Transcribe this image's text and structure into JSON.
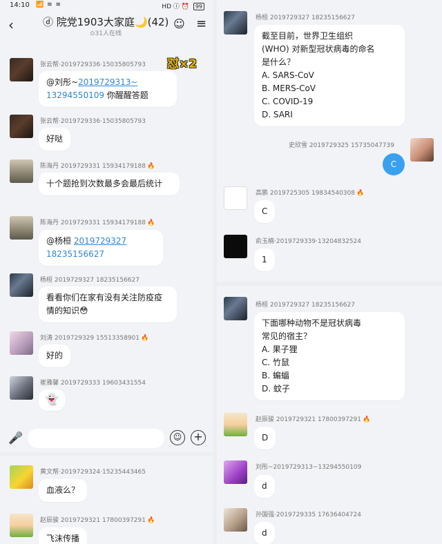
{
  "status": {
    "time": "14:10",
    "signal": "📶 ≋ ≋",
    "right": "HD ⓘ ⏰ ",
    "battery": "99"
  },
  "header": {
    "back": "‹",
    "title": "ⓓ 院党1903大家庭🌙(42)",
    "subtitle": "⊙31人在线",
    "hat_icon": "☺",
    "menu_icon": "≡"
  },
  "badge_x2": "怼×2",
  "left_messages": [
    {
      "name": "张云帮·2019729336·15035805793",
      "text": "@刘彤~2019729313~13294550109 你醒醒答题",
      "mention": "2019729313~",
      "number": "13294550109",
      "tail": " 你醒醒答题",
      "lead": "@刘彤~"
    },
    {
      "name": "张云帮·2019729336·15035805793",
      "text": "好哒"
    },
    {
      "name": "陈海丹 2019729331 15934179188",
      "fire": "🔥",
      "text": "十个题抢到次数最多会最后统计"
    },
    {
      "name": "陈海丹 2019729331 15934179188",
      "fire": "🔥",
      "lead": "@杨桓 ",
      "mention": "2019729327",
      "number": "18235156627"
    },
    {
      "name": "杨桓 2019729327 18235156627",
      "text": "看看你们在家有没有关注防疫疫情的知识",
      "emoji": "😳"
    },
    {
      "name": "刘涛 2019729329 15513358901",
      "fire": "🔥",
      "text": "好的"
    },
    {
      "name": "崔雅馨 2019729333 19603431554",
      "text": "👻"
    }
  ],
  "input": {
    "placeholder": "",
    "mic_icon": "🎤",
    "emoji_icon": "☺",
    "plus_icon": "+"
  },
  "left_b_messages": [
    {
      "name": "黄文帮·2019729324·15235443465",
      "text": "血液么？"
    },
    {
      "name": "赵辰骏 2019729321 17800397291",
      "fire": "🔥",
      "text": "飞沫传播"
    }
  ],
  "right_top": {
    "question": {
      "name": "杨桓 2019729327 18235156627",
      "lines": [
        "截至目前，世界卫生组织",
        "(WHO) 对新型冠状病毒的命名",
        "是什么？",
        "A. SARS-CoV",
        "B. MERS-CoV",
        "C. COVID-19",
        "D. SARI"
      ]
    },
    "own": {
      "name": "史欣雪 2019729325 15735047739",
      "text": "C"
    },
    "answers": [
      {
        "name": "高鹏 2019725305 19834540308",
        "fire": "🔥",
        "text": "C"
      },
      {
        "name": "俞玉楠·2019729339·13204832524",
        "text": "1"
      }
    ]
  },
  "right_bot": {
    "question": {
      "name": "杨桓 2019729327 18235156627",
      "lines": [
        "下面哪种动物不是冠状病毒",
        "常见的宿主？",
        "A. 果子狸",
        "C. 竹鼠",
        "B. 蝙蝠",
        "D. 蚊子"
      ]
    },
    "answers": [
      {
        "name": "赵辰骏 2019729321 17800397291",
        "fire": "🔥",
        "text": "D"
      },
      {
        "name": "刘彤~2019729313~13294550109",
        "text": "d"
      },
      {
        "name": "孙国强·2019729335 17636404724",
        "text": "d"
      }
    ]
  }
}
